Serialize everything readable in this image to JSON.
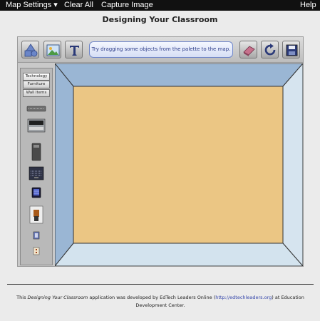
{
  "menu": {
    "map_settings": "Map Settings ▾",
    "clear_all": "Clear All",
    "capture_image": "Capture Image",
    "help": "Help"
  },
  "page_title": "Designing Your Classroom",
  "toolbar": {
    "hint": "Try dragging some objects from the palette to the map.",
    "left_tools": [
      "shapes-icon",
      "image-icon",
      "text-icon"
    ],
    "right_tools": [
      "eraser-icon",
      "rotate-icon",
      "save-icon"
    ]
  },
  "palette": {
    "categories": [
      "Technology",
      "Furniture",
      "Wall Items"
    ],
    "active_category": "Technology",
    "items": [
      "keyboard-icon",
      "projector-icon",
      "computer-tower-icon",
      "laptop-icon",
      "tablet-icon",
      "document-camera-icon",
      "wall-outlet-icon",
      "network-jack-icon"
    ]
  },
  "room": {
    "floor_color": "#ebc684",
    "wall_top_color": "#9ab6d4",
    "wall_side_color": "#d6e4ef",
    "wall_bottom_color": "#d3e3ee"
  },
  "footer": {
    "prefix": "This ",
    "app_name": "Designing Your Classroom",
    "middle": " application was developed by EdTech Leaders Online (",
    "link": "http://edtechleaders.org",
    "suffix": ") at Education Development Center."
  }
}
